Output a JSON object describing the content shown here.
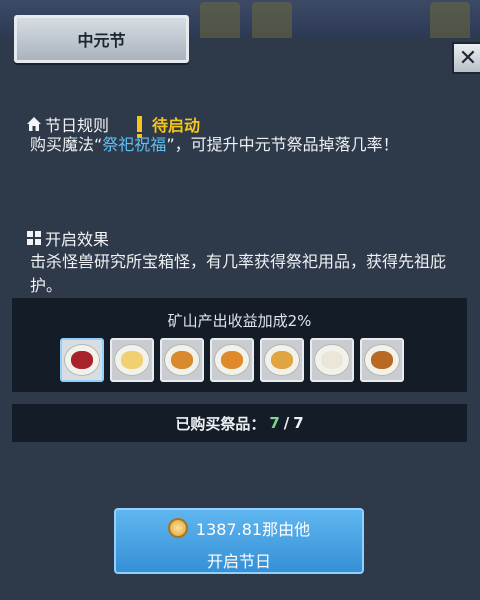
{
  "title": "中元节",
  "close_icon": "close-icon",
  "rules": {
    "heading": "节日规则",
    "icon": "home-icon",
    "status": "待启动",
    "desc_pre": "购买魔法“",
    "desc_highlight": "祭祀祝福",
    "desc_post": "”，可提升中元节祭品掉落几率！"
  },
  "effect": {
    "heading": "开启效果",
    "icon": "grid-icon",
    "desc": "击杀怪兽研究所宝箱怪，有几率获得祭祀用品，获得先祖庇护。"
  },
  "bonus": {
    "text": "矿山产出收益加成2%",
    "items": [
      {
        "name": "offering-berries-icon",
        "color": "#a8222c"
      },
      {
        "name": "offering-dumplings-icon",
        "color": "#f0d070"
      },
      {
        "name": "offering-buns-icon",
        "color": "#d88a2c"
      },
      {
        "name": "offering-pastries-icon",
        "color": "#e08a2c"
      },
      {
        "name": "offering-noodles-icon",
        "color": "#e0a440"
      },
      {
        "name": "offering-rice-balls-icon",
        "color": "#ece6d8"
      },
      {
        "name": "offering-roast-chicken-icon",
        "color": "#b86a24"
      }
    ]
  },
  "purchased": {
    "label": "已购买祭品：",
    "current": "7",
    "separator": "/",
    "total": "7"
  },
  "open_button": {
    "cost": "1387.81那由他",
    "label": "开启节日",
    "coin_icon": "coin-icon"
  },
  "colors": {
    "panel": "#2e3a4a",
    "highlight": "#5ec0f5",
    "pending": "#f5c518",
    "count_green": "#7fd98a",
    "button": "#3590d6"
  }
}
